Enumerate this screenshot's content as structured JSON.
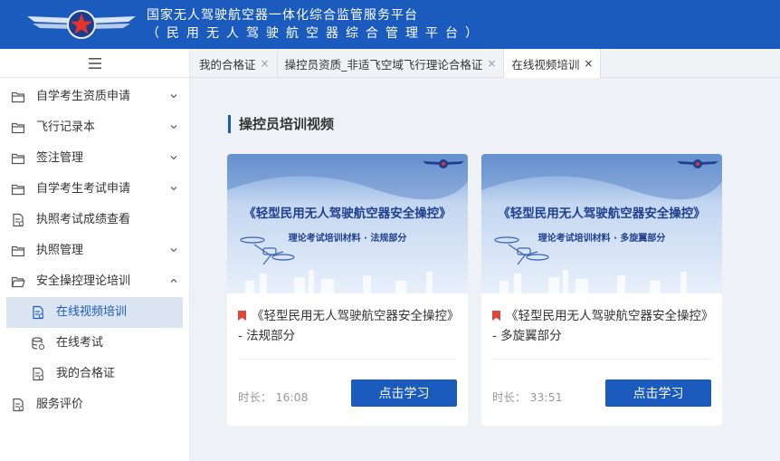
{
  "header": {
    "title_line1": "国家无人驾驶航空器一体化综合监管服务平台",
    "title_line2": "（民用无人驾驶航空器综合管理平台）"
  },
  "sidebar": {
    "items": [
      {
        "label": "自学考生资质申请",
        "icon": "folder-icon",
        "chevron": "down"
      },
      {
        "label": "飞行记录本",
        "icon": "folder-icon",
        "chevron": "down"
      },
      {
        "label": "签注管理",
        "icon": "folder-icon",
        "chevron": "down"
      },
      {
        "label": "自学考生考试申请",
        "icon": "folder-icon",
        "chevron": "down"
      },
      {
        "label": "执照考试成绩查看",
        "icon": "document-icon",
        "chevron": ""
      },
      {
        "label": "执照管理",
        "icon": "folder-icon",
        "chevron": "down"
      },
      {
        "label": "安全操控理论培训",
        "icon": "folder-open-icon",
        "chevron": "up"
      }
    ],
    "sub_items": [
      {
        "label": "在线视频培训",
        "icon": "document-icon",
        "active": true
      },
      {
        "label": "在线考试",
        "icon": "database-icon",
        "active": false
      },
      {
        "label": "我的合格证",
        "icon": "document-icon",
        "active": false
      }
    ],
    "bottom_item": {
      "label": "服务评价",
      "icon": "document-icon"
    }
  },
  "tabs": [
    {
      "label": "我的合格证",
      "active": false
    },
    {
      "label": "操控员资质_非适飞空域飞行理论合格证",
      "active": false
    },
    {
      "label": "在线视频培训",
      "active": true
    }
  ],
  "tab_close": "×",
  "main": {
    "section_title": "操控员培训视频",
    "cards": [
      {
        "thumb_title": "《轻型民用无人驾驶航空器安全操控》",
        "thumb_subtitle": "理论考试培训材料 · 法规部分",
        "title": "《轻型民用无人驾驶航空器安全操控》 - 法规部分",
        "duration_label": "时长：",
        "duration": "16:08",
        "button": "点击学习"
      },
      {
        "thumb_title": "《轻型民用无人驾驶航空器安全操控》",
        "thumb_subtitle": "理论考试培训材料 · 多旋翼部分",
        "title": "《轻型民用无人驾驶航空器安全操控》 - 多旋翼部分",
        "duration_label": "时长：",
        "duration": "33:51",
        "button": "点击学习"
      }
    ]
  },
  "colors": {
    "brand": "#1a5bbd",
    "accent_red": "#e0463c",
    "active_bg": "#dbe5f2"
  }
}
